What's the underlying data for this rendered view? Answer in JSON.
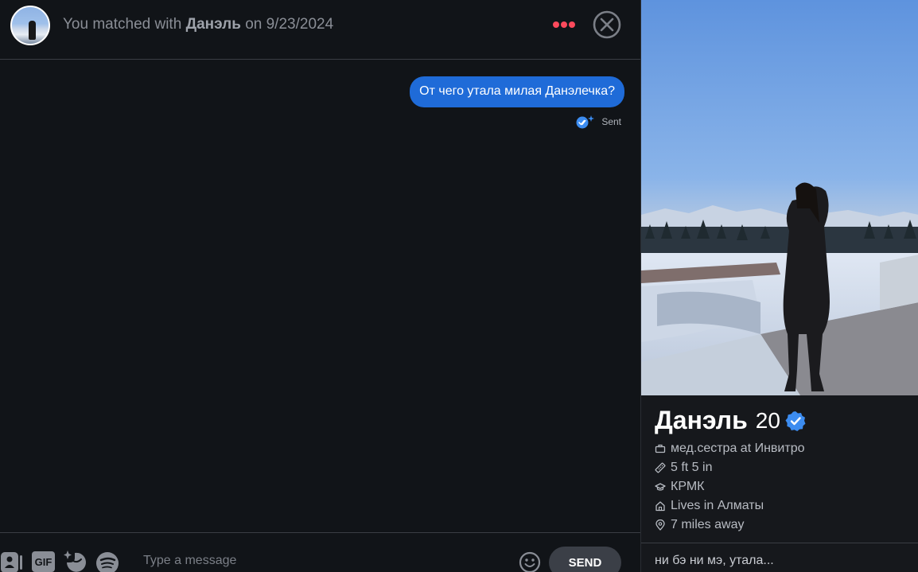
{
  "header": {
    "match_prefix": "You matched with ",
    "match_name": "Данэль",
    "match_suffix": " on 9/23/2024"
  },
  "messages": [
    {
      "text": "От чего утала милая Данэлечка?",
      "status": "Sent"
    }
  ],
  "composer": {
    "placeholder": "Type a message",
    "gif_label": "GIF",
    "send_label": "SEND"
  },
  "profile": {
    "name": "Данэль",
    "age": "20",
    "facts": [
      {
        "icon": "briefcase-icon",
        "text": "мед.сестра at Инвитро"
      },
      {
        "icon": "ruler-icon",
        "text": "5 ft 5 in"
      },
      {
        "icon": "graduation-cap-icon",
        "text": "КРМК"
      },
      {
        "icon": "home-icon",
        "text": "Lives in Алматы"
      },
      {
        "icon": "location-pin-icon",
        "text": "7 miles away"
      }
    ],
    "bio": "ни бэ ни мэ, утала..."
  },
  "colors": {
    "accent_red": "#fd4a5c",
    "bubble_blue": "#1f6bd8",
    "verified_blue": "#3c8cf0",
    "background": "#111418"
  }
}
